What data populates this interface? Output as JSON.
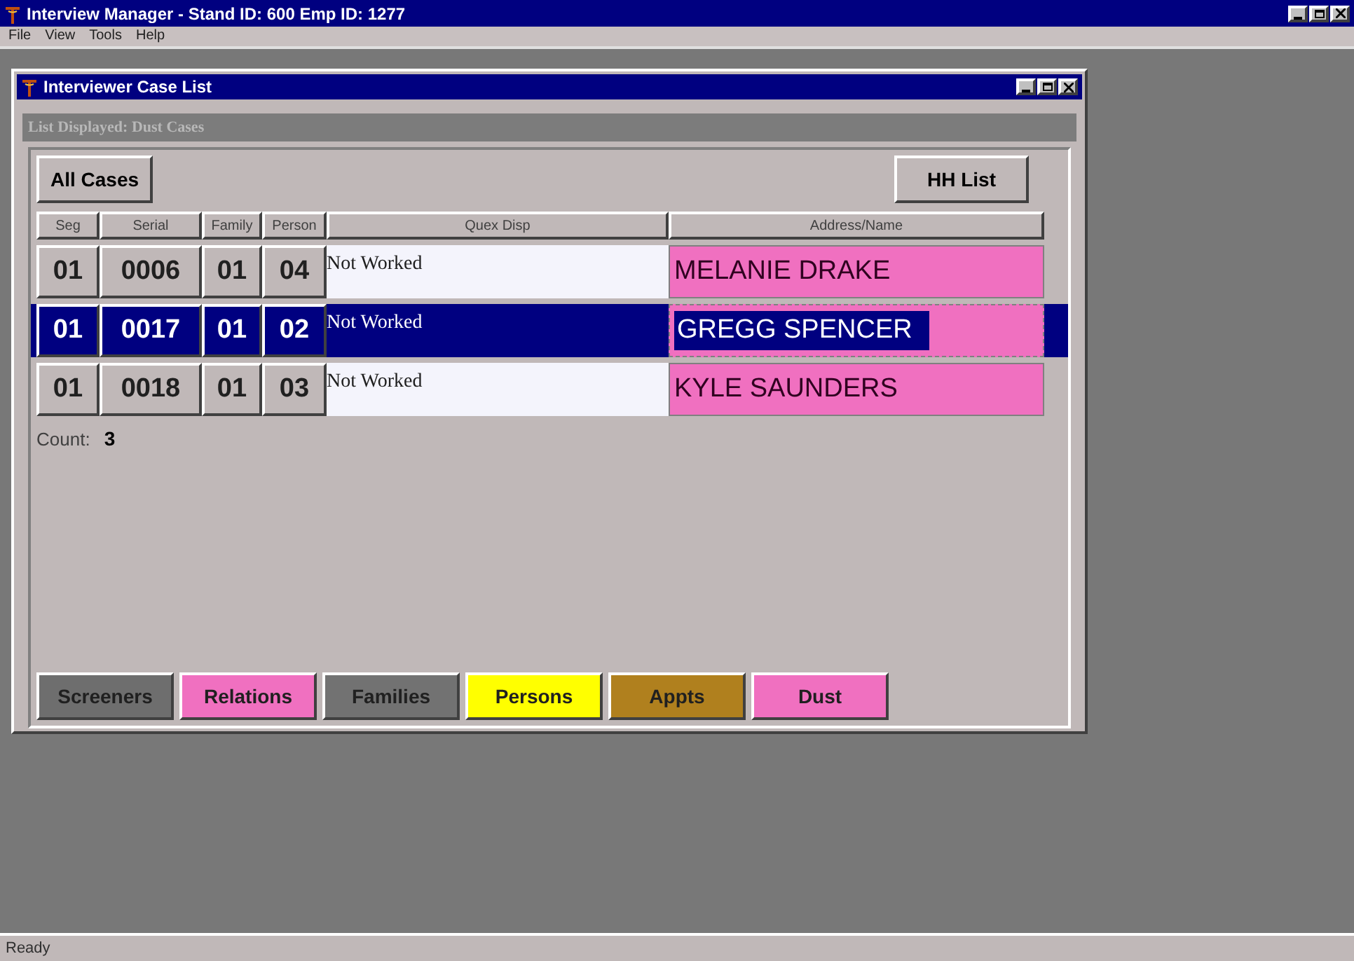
{
  "window": {
    "title": "Interview Manager - Stand ID: 600  Emp ID: 1277"
  },
  "menu": [
    "File",
    "View",
    "Tools",
    "Help"
  ],
  "child_window": {
    "title": "Interviewer Case List",
    "list_displayed": "List Displayed: Dust Cases",
    "buttons": {
      "left": "All Cases",
      "right": "HH List"
    },
    "table": {
      "columns": [
        "Seg",
        "Serial",
        "Family",
        "Person",
        "Quex Disp",
        "Address/Name"
      ],
      "rows": [
        {
          "seg": "01",
          "serial": "0006",
          "family": "01",
          "person": "04",
          "quex_disp": "Not Worked",
          "name": "MELANIE DRAKE",
          "selected": false
        },
        {
          "seg": "01",
          "serial": "0017",
          "family": "01",
          "person": "02",
          "quex_disp": "Not Worked",
          "name": "GREGG SPENCER",
          "selected": true
        },
        {
          "seg": "01",
          "serial": "0018",
          "family": "01",
          "person": "03",
          "quex_disp": "Not Worked",
          "name": "KYLE SAUNDERS",
          "selected": false
        }
      ]
    },
    "count": {
      "label": "Count:",
      "value": "3"
    },
    "tabs": [
      {
        "label": "Screeners",
        "color": "#6e6e6e"
      },
      {
        "label": "Relations",
        "color": "#f070c0"
      },
      {
        "label": "Families",
        "color": "#727272"
      },
      {
        "label": "Persons",
        "color": "#ffff00"
      },
      {
        "label": "Appts",
        "color": "#b0801e"
      },
      {
        "label": "Dust",
        "color": "#f070c0"
      }
    ]
  },
  "status_bar": "Ready"
}
